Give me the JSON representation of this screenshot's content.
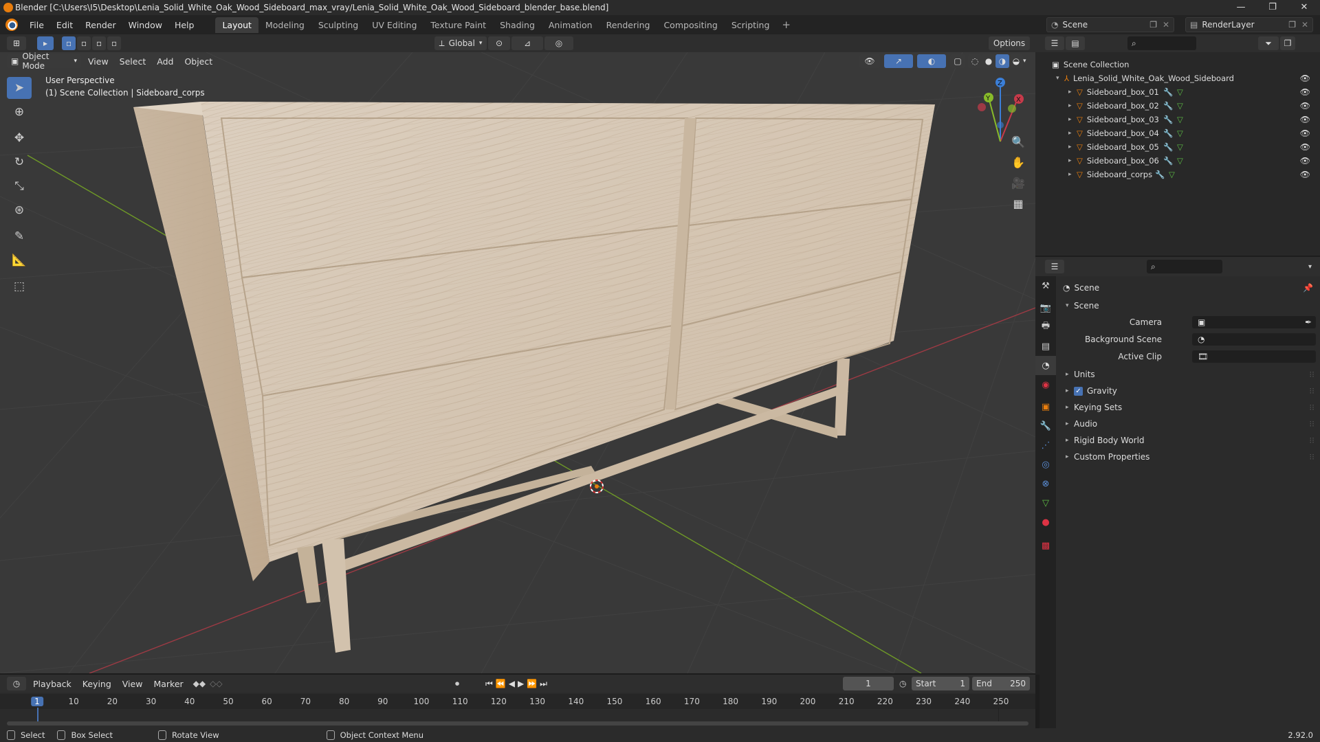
{
  "window": {
    "title": "Blender [C:\\Users\\I5\\Desktop\\Lenia_Solid_White_Oak_Wood_Sideboard_max_vray/Lenia_Solid_White_Oak_Wood_Sideboard_blender_base.blend]",
    "controls": [
      "—",
      "❐",
      "✕"
    ]
  },
  "menubar": {
    "menus": [
      "File",
      "Edit",
      "Render",
      "Window",
      "Help"
    ],
    "workspaces": [
      "Layout",
      "Modeling",
      "Sculpting",
      "UV Editing",
      "Texture Paint",
      "Shading",
      "Animation",
      "Rendering",
      "Compositing",
      "Scripting"
    ],
    "active_workspace": "Layout",
    "scene": "Scene",
    "view_layer": "RenderLayer"
  },
  "viewport": {
    "transform_orientation": "Global",
    "options_label": "Options",
    "mode": "Object Mode",
    "menus": [
      "View",
      "Select",
      "Add",
      "Object"
    ],
    "view_name": "User Perspective",
    "context": "(1) Scene Collection | Sideboard_corps",
    "gizmo_axes": [
      "X",
      "Y",
      "Z"
    ]
  },
  "outliner": {
    "root": "Scene Collection",
    "collection": "Lenia_Solid_White_Oak_Wood_Sideboard",
    "objects": [
      "Sideboard_box_01",
      "Sideboard_box_02",
      "Sideboard_box_03",
      "Sideboard_box_04",
      "Sideboard_box_05",
      "Sideboard_box_06",
      "Sideboard_corps"
    ]
  },
  "properties": {
    "context": "Scene",
    "panel": "Scene",
    "fields": [
      {
        "label": "Camera",
        "value": ""
      },
      {
        "label": "Background Scene",
        "value": ""
      },
      {
        "label": "Active Clip",
        "value": ""
      }
    ],
    "sections": [
      "Units",
      "Gravity",
      "Keying Sets",
      "Audio",
      "Rigid Body World",
      "Custom Properties"
    ],
    "gravity_checked": true
  },
  "timeline": {
    "menus": [
      "Playback",
      "Keying",
      "View",
      "Marker"
    ],
    "current_frame": "1",
    "start_label": "Start",
    "start": "1",
    "end_label": "End",
    "end": "250",
    "ticks": [
      "1",
      "10",
      "20",
      "30",
      "40",
      "50",
      "60",
      "70",
      "80",
      "90",
      "100",
      "110",
      "120",
      "130",
      "140",
      "150",
      "160",
      "170",
      "180",
      "190",
      "200",
      "210",
      "220",
      "230",
      "240",
      "250"
    ]
  },
  "statusbar": {
    "items": [
      "Select",
      "Box Select",
      "Rotate View",
      "Object Context Menu"
    ],
    "version": "2.92.0"
  },
  "colors": {
    "accent": "#4772b3",
    "object_orange": "#e87d0d",
    "x_axis": "#c73a4a",
    "y_axis": "#88bb2a",
    "z_axis": "#3b7fd8"
  }
}
